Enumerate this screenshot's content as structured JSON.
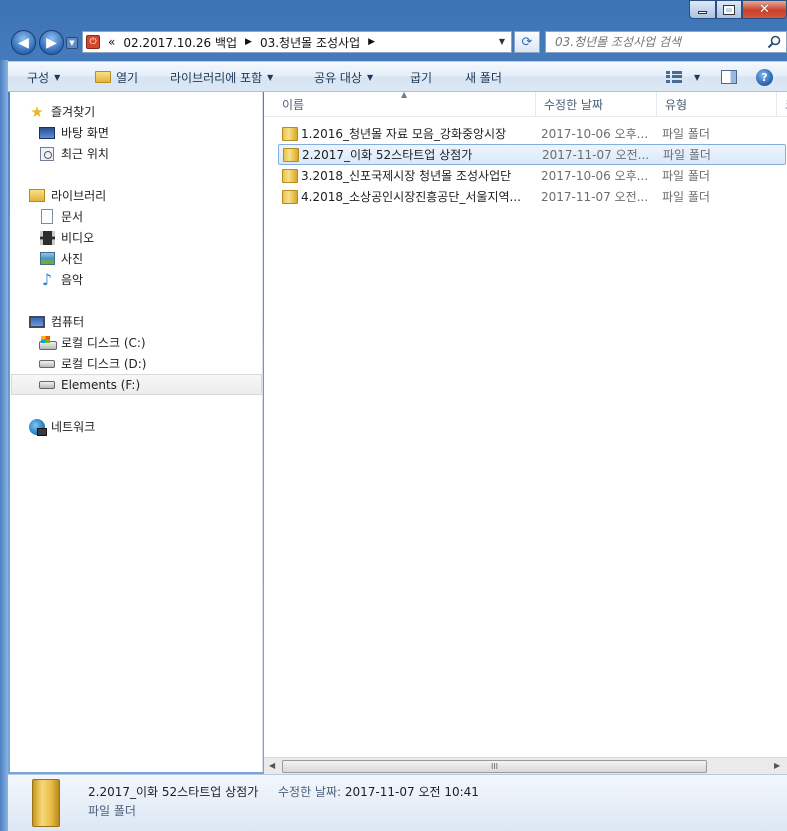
{
  "window": {
    "min_label": "",
    "max_label": "",
    "close_label": "✕"
  },
  "address": {
    "overflow": "«",
    "segments": [
      "02.2017.10.26 백업",
      "03.청년몰 조성사업"
    ]
  },
  "search": {
    "placeholder": "03.청년몰 조성사업 검색"
  },
  "toolbar": {
    "organize": "구성",
    "open": "열기",
    "include_library": "라이브러리에 포함",
    "share": "공유 대상",
    "burn": "굽기",
    "new_folder": "새 폴더"
  },
  "navpane": {
    "favorites": "즐겨찾기",
    "desktop": "바탕 화면",
    "recent": "최근 위치",
    "libraries": "라이브러리",
    "documents": "문서",
    "videos": "비디오",
    "pictures": "사진",
    "music": "음악",
    "computer": "컴퓨터",
    "disk_c": "로컬 디스크 (C:)",
    "disk_d": "로컬 디스크 (D:)",
    "disk_f": "Elements (F:)",
    "network": "네트워크"
  },
  "columns": {
    "name": "이름",
    "date": "수정한 날짜",
    "type": "유형",
    "size": "크"
  },
  "files": [
    {
      "name": "1.2016_청년몰 자료 모음_강화중앙시장",
      "date": "2017-10-06 오후...",
      "type": "파일 폴더"
    },
    {
      "name": "2.2017_이화 52스타트업 상점가",
      "date": "2017-11-07 오전...",
      "type": "파일 폴더"
    },
    {
      "name": "3.2018_신포국제시장 청년몰 조성사업단",
      "date": "2017-10-06 오후...",
      "type": "파일 폴더"
    },
    {
      "name": "4.2018_소상공인시장진흥공단_서울지역...",
      "date": "2017-11-07 오전...",
      "type": "파일 폴더"
    }
  ],
  "scrollbar": {
    "grip": "III"
  },
  "details": {
    "name": "2.2017_이화 52스타트업 상점가",
    "date_label": "수정한 날짜:",
    "date_value": "2017-11-07 오전 10:41",
    "type": "파일 폴더"
  },
  "colors": {
    "accent": "#3c73b5",
    "selection": "#d9e9fb",
    "folder": "#e2b43c"
  }
}
